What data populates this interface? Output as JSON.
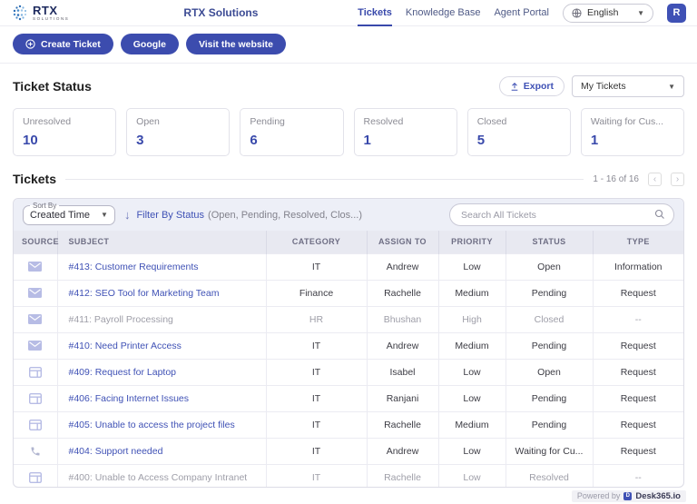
{
  "header": {
    "logo": {
      "text": "RTX",
      "subtext": "SOLUTIONS"
    },
    "title": "RTX Solutions",
    "nav": [
      {
        "label": "Tickets",
        "active": true
      },
      {
        "label": "Knowledge Base",
        "active": false
      },
      {
        "label": "Agent Portal",
        "active": false
      }
    ],
    "language": {
      "selected": "English"
    },
    "avatar": "R"
  },
  "actions": {
    "create_ticket": "Create Ticket",
    "google": "Google",
    "visit_website": "Visit the website"
  },
  "status_section": {
    "title": "Ticket Status",
    "export_label": "Export",
    "view_filter": "My Tickets",
    "cards": [
      {
        "label": "Unresolved",
        "count": "10"
      },
      {
        "label": "Open",
        "count": "3"
      },
      {
        "label": "Pending",
        "count": "6"
      },
      {
        "label": "Resolved",
        "count": "1"
      },
      {
        "label": "Closed",
        "count": "5"
      },
      {
        "label": "Waiting for Cus...",
        "count": "1"
      }
    ]
  },
  "tickets_section": {
    "title": "Tickets",
    "pagination": "1 - 16 of 16",
    "prev_label": "‹",
    "next_label": "›",
    "sort_by_label": "Sort By",
    "sort_by_value": "Created Time",
    "sort_direction_icon": "arrow-down-icon",
    "filter_link": "Filter By Status",
    "filter_detail": "(Open, Pending, Resolved, Clos...)",
    "search_placeholder": "Search All Tickets"
  },
  "table": {
    "columns": [
      "SOURCE",
      "SUBJECT",
      "CATEGORY",
      "ASSIGN TO",
      "PRIORITY",
      "STATUS",
      "TYPE"
    ],
    "rows": [
      {
        "source": "email-icon",
        "subject": "#413: Customer Requirements",
        "category": "IT",
        "assign_to": "Andrew",
        "priority": "Low",
        "status": "Open",
        "type": "Information",
        "muted": false
      },
      {
        "source": "email-icon",
        "subject": "#412: SEO Tool for Marketing Team",
        "category": "Finance",
        "assign_to": "Rachelle",
        "priority": "Medium",
        "status": "Pending",
        "type": "Request",
        "muted": false
      },
      {
        "source": "email-icon",
        "subject": "#411: Payroll Processing",
        "category": "HR",
        "assign_to": "Bhushan",
        "priority": "High",
        "status": "Closed",
        "type": "--",
        "muted": true
      },
      {
        "source": "email-icon",
        "subject": "#410: Need Printer Access",
        "category": "IT",
        "assign_to": "Andrew",
        "priority": "Medium",
        "status": "Pending",
        "type": "Request",
        "muted": false
      },
      {
        "source": "webform-icon",
        "subject": "#409: Request for Laptop",
        "category": "IT",
        "assign_to": "Isabel",
        "priority": "Low",
        "status": "Open",
        "type": "Request",
        "muted": false
      },
      {
        "source": "webform-icon",
        "subject": "#406: Facing Internet Issues",
        "category": "IT",
        "assign_to": "Ranjani",
        "priority": "Low",
        "status": "Pending",
        "type": "Request",
        "muted": false
      },
      {
        "source": "webform-icon",
        "subject": "#405: Unable to access the project files",
        "category": "IT",
        "assign_to": "Rachelle",
        "priority": "Medium",
        "status": "Pending",
        "type": "Request",
        "muted": false
      },
      {
        "source": "phone-icon",
        "subject": "#404: Support needed",
        "category": "IT",
        "assign_to": "Andrew",
        "priority": "Low",
        "status": "Waiting for Cu...",
        "type": "Request",
        "muted": false
      },
      {
        "source": "webform-icon",
        "subject": "#400: Unable to Access Company Intranet",
        "category": "IT",
        "assign_to": "Rachelle",
        "priority": "Low",
        "status": "Resolved",
        "type": "--",
        "muted": true
      }
    ]
  },
  "footer": {
    "powered_by": "Powered by",
    "brand": "Desk365.io"
  },
  "colors": {
    "primary": "#3c4cae",
    "link": "#3f51b5",
    "count": "#3949ab",
    "muted_text": "#9e9ea8",
    "table_header_bg": "#e8e9f1",
    "filter_bar_bg": "#edeff7"
  }
}
